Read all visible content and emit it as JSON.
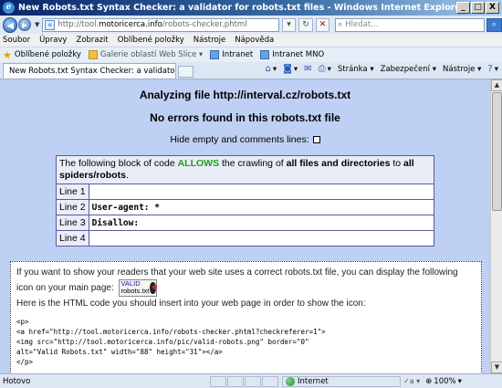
{
  "window": {
    "title": "New Robots.txt Syntax Checker: a validator for robots.txt files - Windows Internet Explorer",
    "buttons": [
      "_",
      "□",
      "X"
    ]
  },
  "address": {
    "url_prefix": "http://tool.",
    "url_host": "motoricerca.info",
    "url_path": "/robots-checker.phtml",
    "search_placeholder": "Hledat..."
  },
  "menu": [
    "Soubor",
    "Úpravy",
    "Zobrazit",
    "Oblíbené položky",
    "Nástroje",
    "Nápověda"
  ],
  "favorites": {
    "label": "Oblíbené položky",
    "items": [
      "Galerie oblastí Web Slice ▾",
      "Intranet",
      "Intranet MNO"
    ]
  },
  "tab": {
    "label": "New Robots.txt Syntax Checker: a validator for robot..."
  },
  "commandbar": {
    "items": [
      "Stránka ▾",
      "Zabezpečení ▾",
      "Nástroje ▾"
    ]
  },
  "page": {
    "analyzing": "Analyzing file http://interval.cz/robots.txt",
    "no_errors": "No errors found in this robots.txt file",
    "hide_label": "Hide empty and comments lines:",
    "table": {
      "caption_pre": "The following block of code ",
      "caption_allows": "ALLOWS",
      "caption_mid": " the crawling of ",
      "caption_bold1": "all files and directories",
      "caption_to": " to ",
      "caption_bold2": "all spiders/robots",
      "caption_end": ".",
      "rows": [
        {
          "line": "Line 1",
          "code": ""
        },
        {
          "line": "Line 2",
          "code": "User-agent: *"
        },
        {
          "line": "Line 3",
          "code": "Disallow:"
        },
        {
          "line": "Line 4",
          "code": ""
        }
      ]
    },
    "info": {
      "p1": "If you want to show your readers that your web site uses a correct robots.txt file, you can display the following icon on your main page:",
      "badge_line1": "VALID",
      "badge_line2": "robots.txt",
      "p2": "Here is the HTML code you should insert into your web page in order to show the icon:",
      "code": "<p>\n<a href=\"http://tool.motoricerca.info/robots-checker.phtml?checkreferer=1\">\n<img src=\"http://tool.motoricerca.info/pic/valid-robots.png\" border=\"0\"\nalt=\"Valid Robots.txt\" width=\"88\" height=\"31\"></a>\n</p>"
    }
  },
  "status": {
    "text": "Hotovo",
    "zone": "Internet",
    "protected": "✓a ▾",
    "zoom": "100%"
  }
}
